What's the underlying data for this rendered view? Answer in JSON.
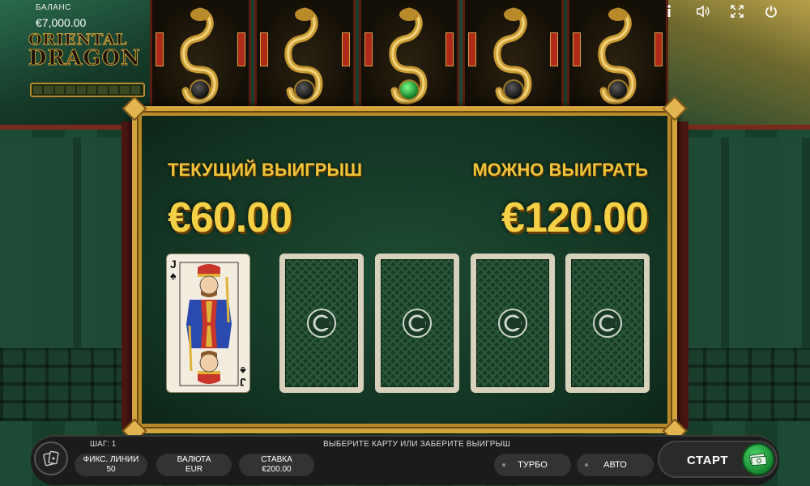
{
  "balance": {
    "label": "БАЛАНС",
    "value": "€7,000.00"
  },
  "logo": {
    "line1": "ORIENTAL",
    "line2": "DRAGON"
  },
  "progress": {
    "segments": 10,
    "filled": 0
  },
  "top_icons": [
    "info-icon",
    "sound-icon",
    "fullscreen-icon",
    "power-icon"
  ],
  "reels": {
    "count": 5,
    "highlighted_index": 2
  },
  "gamble": {
    "current_win_label": "ТЕКУЩИЙ ВЫИГРЫШ",
    "current_win_value": "€60.00",
    "possible_win_label": "МОЖНО ВЫИГРАТЬ",
    "possible_win_value": "€120.00",
    "dealer_card": {
      "rank": "J",
      "suit": "♠",
      "name": "Jack of Spades"
    },
    "hidden_cards": 4
  },
  "bottom": {
    "step": "ШАГ: 1",
    "instruction": "ВЫБЕРИТЕ КАРТУ ИЛИ ЗАБЕРИТЕ ВЫИГРЫШ",
    "fixed_lines_label": "ФИКС. ЛИНИИ",
    "fixed_lines_value": "50",
    "currency_label": "ВАЛЮТА",
    "currency_value": "EUR",
    "bet_label": "СТАВКА",
    "bet_value": "€200.00",
    "turbo_label": "ТУРБО",
    "auto_label": "АВТО",
    "start_label": "СТАРТ"
  },
  "colors": {
    "gold": "#f4d046",
    "frame": "#d4a43c",
    "felt": "#123322",
    "start_green": "#14832c"
  }
}
